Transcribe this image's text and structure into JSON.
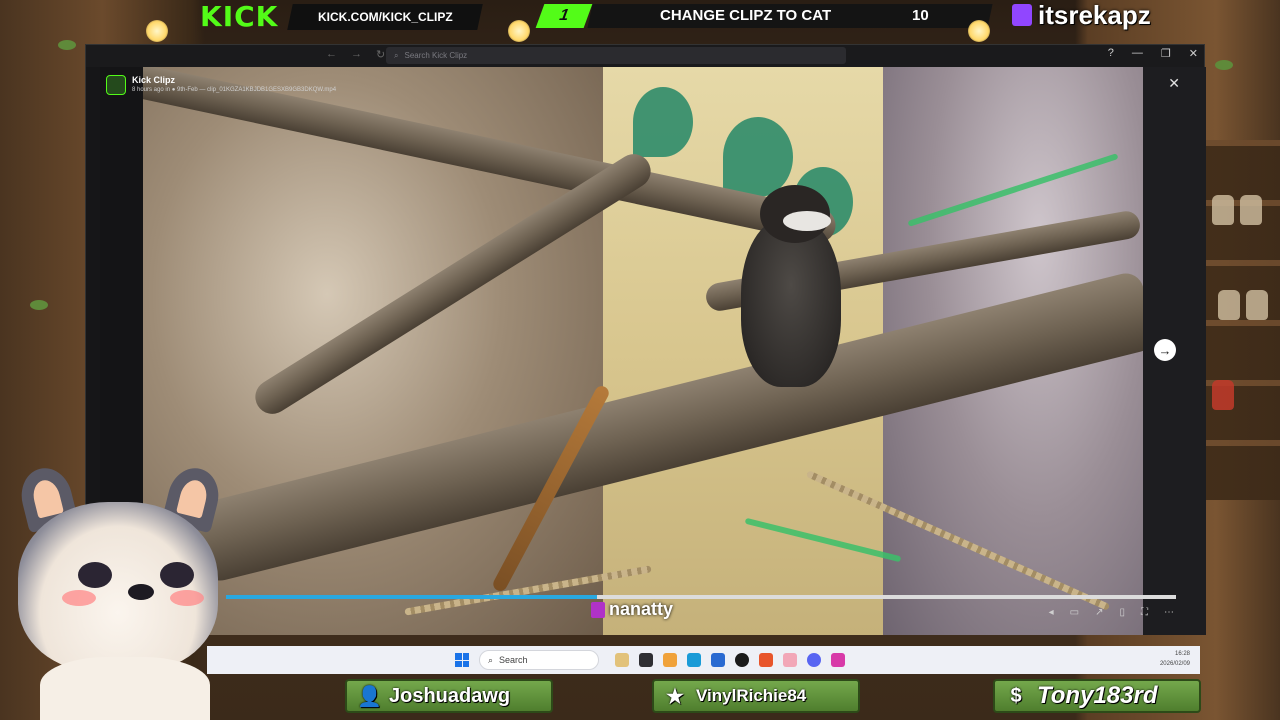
{
  "overlay": {
    "kick_logo": "KICK",
    "kick_url": "KICK.COM/KICK_CLIPZ",
    "goal_count": "1",
    "goal_text": "CHANGE CLIPZ TO CAT",
    "goal_target": "10",
    "streamer_handle": "itsrekapz",
    "brand_color": "#53fc18"
  },
  "window": {
    "search_placeholder": "Search Kick Clipz",
    "controls": {
      "help": "?",
      "minimize": "—",
      "restore": "❐",
      "close": "✕"
    }
  },
  "clip": {
    "channel": "Kick Clipz",
    "meta": "8 hours ago in ● 9th-Feb  — clip_01KGZA1KBJDB1GESXB9GB3DKQW.mp4",
    "progress_percent": 39,
    "watermark": "nanatty",
    "close_glyph": "✕",
    "next_glyph": "→"
  },
  "taskbar": {
    "search_label": "Search",
    "time": "16:28",
    "date": "2026/02/09"
  },
  "plates": {
    "p1": {
      "icon": "person-icon",
      "glyph": "👤",
      "label": "Joshuadawg"
    },
    "p2": {
      "icon": "star-icon",
      "glyph": "★",
      "label": "VinylRichie84"
    },
    "p3": {
      "icon": "dollar-icon",
      "glyph": "$",
      "label": "Tony183rd"
    }
  }
}
